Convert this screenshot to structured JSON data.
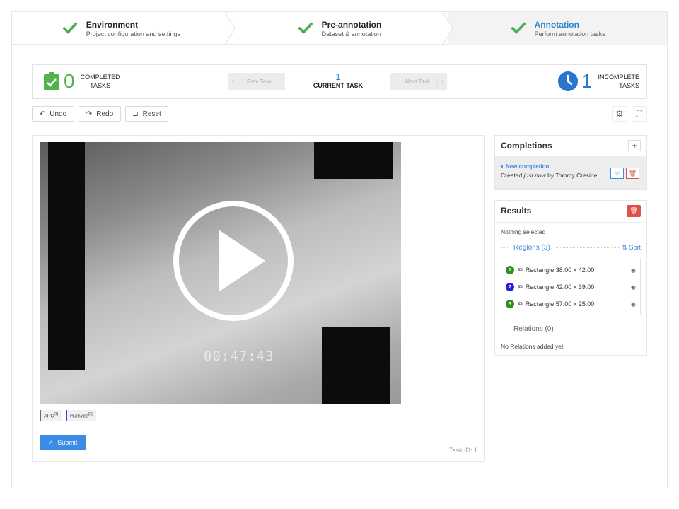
{
  "steps": [
    {
      "title": "Environment",
      "sub": "Project configuration and settings"
    },
    {
      "title": "Pre-annotation",
      "sub": "Dataset & annotation"
    },
    {
      "title": "Annotation",
      "sub": "Perform annotation tasks"
    }
  ],
  "taskbar": {
    "completed_count": "0",
    "completed_label_1": "COMPLETED",
    "completed_label_2": "TASKS",
    "prev_label": "Prev Task",
    "next_label": "Next Task",
    "current_num": "1",
    "current_label": "CURRENT TASK",
    "incomplete_count": "1",
    "incomplete_label_1": "INCOMPLETE",
    "incomplete_label_2": "TASKS"
  },
  "toolbar": {
    "undo": "Undo",
    "redo": "Redo",
    "reset": "Reset"
  },
  "video": {
    "timestamp": "00:47:43"
  },
  "labels": [
    {
      "name": "APC",
      "hotkey": "[1]",
      "color": "#2f8f3f"
    },
    {
      "name": "Humvee",
      "hotkey": "[2]",
      "color": "#4a3cd8"
    }
  ],
  "submit_label": "Submit",
  "task_id": "Task ID: 1",
  "completions": {
    "title": "Completions",
    "item_title": "New completion",
    "created_prefix": "Created ",
    "created_time": "just now",
    "created_by": " by Tommy Cresine"
  },
  "results": {
    "title": "Results",
    "nothing": "Nothing selected",
    "regions_title": "Regions (3)",
    "sort_label": "Sort",
    "regions": [
      {
        "num": "1",
        "label": "Rectangle 38.00 x 42.00",
        "color": "#2f8f1f"
      },
      {
        "num": "2",
        "label": "Rectangle 42.00 x 39.00",
        "color": "#2a1fe0"
      },
      {
        "num": "3",
        "label": "Rectangle 57.00 x 25.00",
        "color": "#2f8f1f"
      }
    ],
    "relations_title": "Relations (0)",
    "no_relations": "No Relations added yet"
  }
}
